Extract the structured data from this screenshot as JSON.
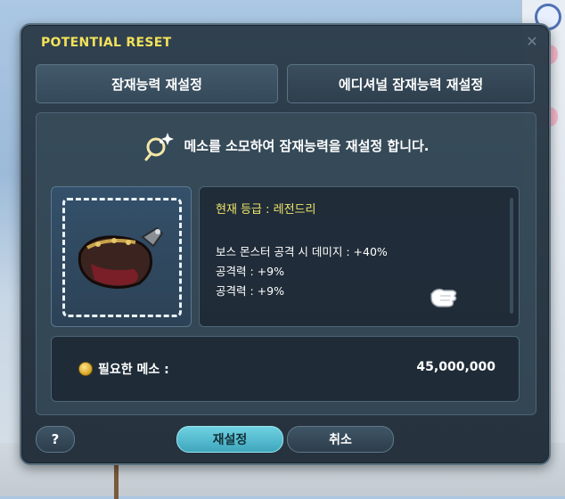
{
  "window": {
    "title": "POTENTIAL RESET"
  },
  "tabs": [
    {
      "label": "잠재능력 재설정",
      "active": true
    },
    {
      "label": "에디셔널 잠재능력 재설정",
      "active": false
    }
  ],
  "banner": {
    "message": "메소를 소모하여 잠재능력을 재설정 합니다."
  },
  "item": {
    "icon": "gauntlet-item-icon"
  },
  "potential": {
    "grade": "현재 등급 : 레전드리",
    "options": [
      "보스 몬스터 공격 시 데미지 : +40%",
      "공격력 : +9%",
      "공격력 : +9%"
    ]
  },
  "cost": {
    "label": "필요한 메소 :",
    "value": "45,000,000"
  },
  "buttons": {
    "help": "?",
    "reset": "재설정",
    "cancel": "취소"
  },
  "colors": {
    "title": "#f3e25a",
    "grade": "#f0e66a",
    "reset_button": "#4fb8cc"
  }
}
